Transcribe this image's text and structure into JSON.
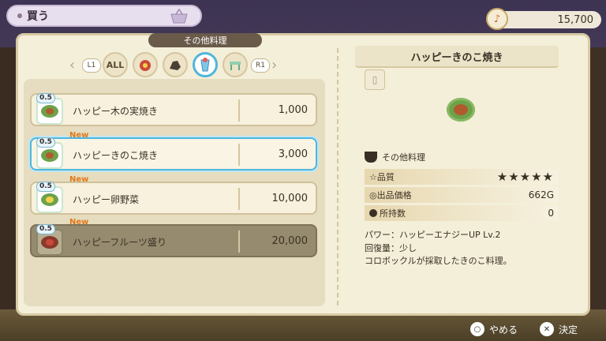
{
  "header": {
    "title": "買う",
    "money": "15,700"
  },
  "category": {
    "current": "その他料理",
    "l_button": "L1",
    "r_button": "R1",
    "all_label": "ALL"
  },
  "items": [
    {
      "rarity": "0.5",
      "name": "ハッピー木の実焼き",
      "price": "1,000",
      "new": ""
    },
    {
      "rarity": "0.5",
      "name": "ハッピーきのこ焼き",
      "price": "3,000",
      "new": "New"
    },
    {
      "rarity": "0.5",
      "name": "ハッピー卵野菜",
      "price": "10,000",
      "new": "New"
    },
    {
      "rarity": "0.5",
      "name": "ハッピーフルーツ盛り",
      "price": "20,000",
      "new": "New"
    }
  ],
  "detail": {
    "title": "ハッピーきのこ焼き",
    "category": "その他料理",
    "quality_label": "☆品質",
    "quality_stars": "★★★★★",
    "price_label": "◎出品価格",
    "price_value": "662G",
    "owned_label": "所持数",
    "owned_value": "0",
    "power": "パワー：ハッピーエナジーUP Lv.2",
    "recovery": "回復量：少し",
    "description": "コロボックルが採取したきのこ料理。"
  },
  "footer": {
    "cancel": "やめる",
    "confirm": "決定",
    "cancel_glyph": "○",
    "confirm_glyph": "✕"
  }
}
